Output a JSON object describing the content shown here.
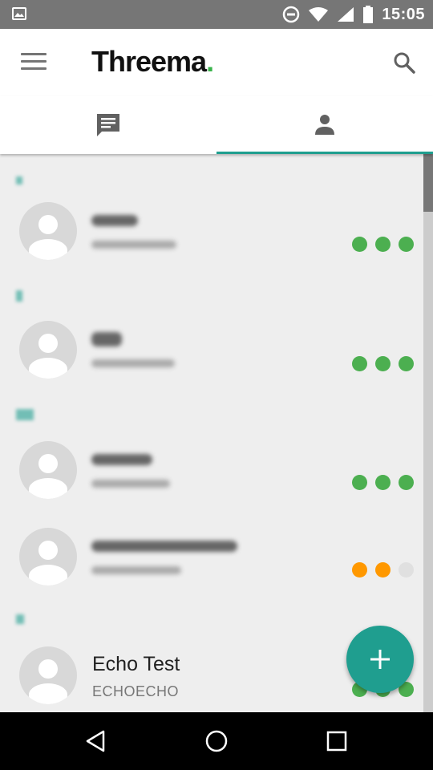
{
  "status_bar": {
    "time": "15:05"
  },
  "app_bar": {
    "title": "Threema",
    "title_dot": "."
  },
  "tabs": [
    {
      "name": "chats",
      "icon": "chat-icon",
      "selected": false
    },
    {
      "name": "contacts",
      "icon": "person-icon",
      "selected": true
    }
  ],
  "contacts": [
    {
      "name": "",
      "id": "",
      "verification": [
        "green",
        "green",
        "green"
      ]
    },
    {
      "name": "",
      "id": "",
      "verification": [
        "green",
        "green",
        "green"
      ]
    },
    {
      "name": "",
      "id": "",
      "verification": [
        "green",
        "green",
        "green"
      ]
    },
    {
      "name": "",
      "id": "",
      "verification": [
        "orange",
        "orange",
        "grey"
      ]
    },
    {
      "name": "Echo Test",
      "id": "ECHOECHO",
      "verification": [
        "green",
        "green",
        "green"
      ]
    }
  ],
  "colors": {
    "accent": "#1f9e8f",
    "green": "#4caf50",
    "orange": "#ff9800",
    "grey": "#e0e0e0",
    "brand_dot": "#38b34a"
  },
  "icons": {
    "menu": "menu-icon",
    "search": "search-icon",
    "fab": "add-icon"
  }
}
